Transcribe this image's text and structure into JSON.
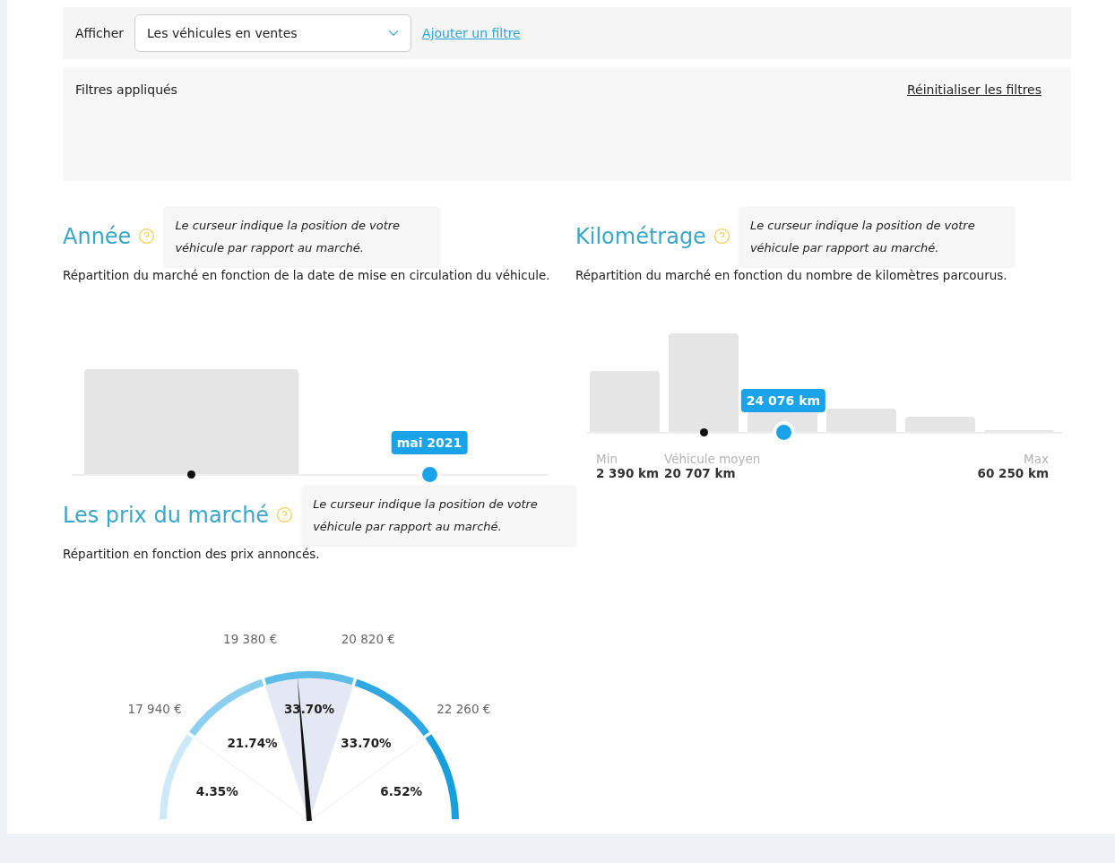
{
  "toolbar": {
    "label": "Afficher",
    "select": {
      "value": "Les véhicules en ventes"
    },
    "link": "Ajouter un filtre"
  },
  "filters": {
    "title": "Filtres appliqués",
    "reset": "Réinitialiser les filtres"
  },
  "sections": [
    {
      "kind": "year",
      "title": "Année",
      "tooltip": "Le curseur indique la position de votre véhicule par rapport au marché.",
      "description": "Répartition du marché en fonction de la date de mise en circulation du véhicule.",
      "average": {
        "level": 0.25
      },
      "vehicle": {
        "level": 0.75,
        "label": "mai 2021"
      }
    },
    {
      "kind": "mileage",
      "title": "Kilométrage",
      "tooltip": "Le curseur indique la position de votre véhicule par rapport au marché.",
      "description": "Répartition du marché en fonction du nombre de kilomètres parcourus.",
      "average": {
        "level": 0.245,
        "label": "Véhicule moyen",
        "value": "20 707 km"
      },
      "vehicle": {
        "level": 0.413,
        "label": "24 076 km"
      },
      "min": {
        "label": "Min",
        "value": "2 390 km"
      },
      "max": {
        "label": "Max",
        "value": "60 250 km"
      }
    },
    {
      "kind": "price",
      "title": "Les prix du marché",
      "tooltip": "Le curseur indique la position de votre véhicule par rapport au marché.",
      "description": "Répartition en fonction des prix annoncés.",
      "thresholds": [
        "17 940 €",
        "19 380 €",
        "20 820 €",
        "22 260 €"
      ],
      "segments": [
        {
          "share": "4.35%",
          "color": "#cde8f6",
          "selected": false
        },
        {
          "share": "21.74%",
          "color": "#8ccfee",
          "selected": false
        },
        {
          "share": "33.70%",
          "color": "#5cbde9",
          "selected": true
        },
        {
          "share": "33.70%",
          "color": "#2ea7e2",
          "selected": false
        },
        {
          "share": "6.52%",
          "color": "#189ddd",
          "selected": false
        }
      ],
      "needle": {
        "level": 0.474
      }
    }
  ]
}
